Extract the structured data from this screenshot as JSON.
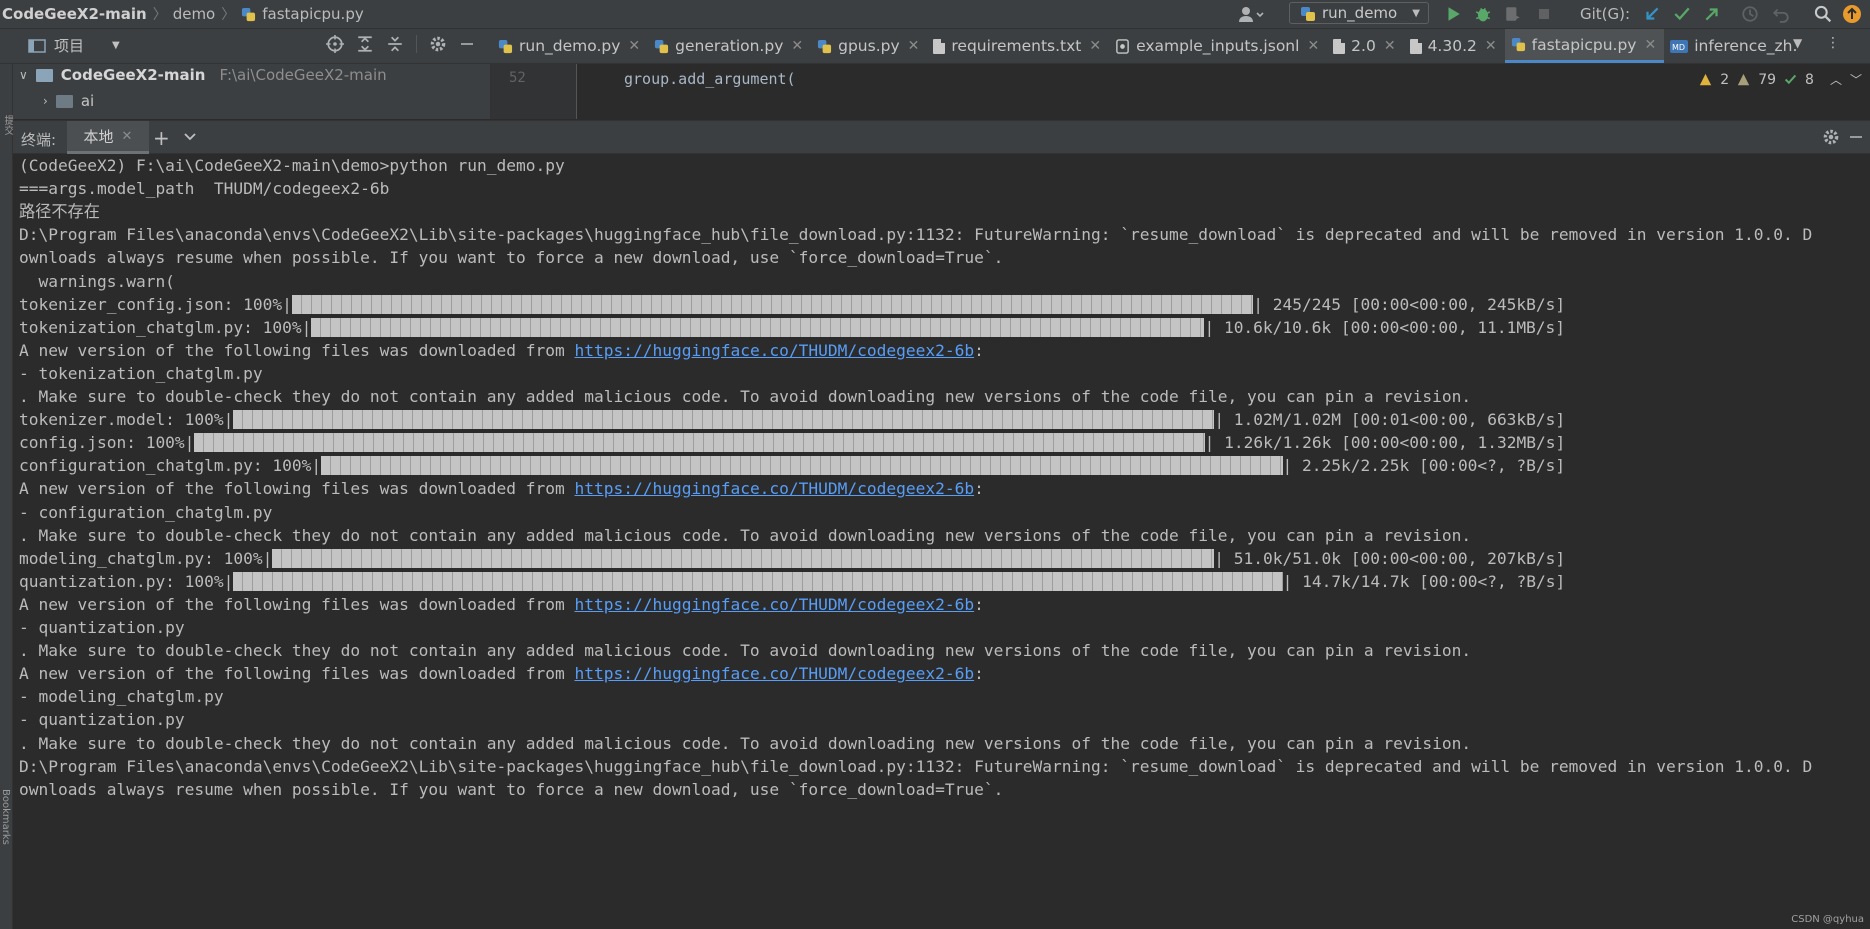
{
  "titlebar": {
    "project": "CodeGeeX2-main",
    "crumb_folder": "demo",
    "crumb_file": "fastapicpu.py",
    "run_config": "run_demo",
    "git_label": "Git(G):"
  },
  "sidebar_strip": {
    "project_label": "项目",
    "bookmarks_label": "Bookmarks",
    "structure_label": "提交"
  },
  "project_tool": {
    "title": "项目"
  },
  "tabs": [
    {
      "label": "run_demo.py",
      "icon": "python-file-icon"
    },
    {
      "label": "generation.py",
      "icon": "python-file-icon"
    },
    {
      "label": "gpus.py",
      "icon": "python-file-icon"
    },
    {
      "label": "requirements.txt",
      "icon": "text-file-icon"
    },
    {
      "label": "example_inputs.jsonl",
      "icon": "json-file-icon"
    },
    {
      "label": "2.0",
      "icon": "text-file-icon"
    },
    {
      "label": "4.30.2",
      "icon": "text-file-icon"
    },
    {
      "label": "fastapicpu.py",
      "icon": "python-file-icon",
      "active": true
    },
    {
      "label": "inference_zh.",
      "icon": "markdown-file-icon"
    }
  ],
  "tree": {
    "root_label": "CodeGeeX2-main",
    "root_path": "F:\\ai\\CodeGeeX2-main",
    "child_label": "ai"
  },
  "editor": {
    "line_number": "52",
    "code_line": "group.add_argument(",
    "errors": "2",
    "warnings": "79",
    "weak_warnings": "8"
  },
  "terminal": {
    "title": "终端:",
    "tab_label": "本地",
    "lines": [
      {
        "text": "(CodeGeeX2) F:\\ai\\CodeGeeX2-main\\demo>python run_demo.py"
      },
      {
        "text": "===args.model_path  THUDM/codegeex2-6b"
      },
      {
        "text": "路径不存在"
      },
      {
        "text": "D:\\Program Files\\anaconda\\envs\\CodeGeeX2\\Lib\\site-packages\\huggingface_hub\\file_download.py:1132: FutureWarning: `resume_download` is deprecated and will be removed in version 1.0.0. D"
      },
      {
        "text": "ownloads always resume when possible. If you want to force a new download, use `force_download=True`."
      },
      {
        "text": "  warnings.warn("
      },
      {
        "prefix": "tokenizer_config.json: 100%|",
        "suffix": "| 245/245 [00:00<00:00, 245kB/s]",
        "progress": 1.0
      },
      {
        "prefix": "tokenization_chatglm.py: 100%|",
        "suffix": "| 10.6k/10.6k [00:00<00:00, 11.1MB/s]",
        "progress": 1.0
      },
      {
        "prefix": "A new version of the following files was downloaded from ",
        "link": "https://huggingface.co/THUDM/codegeex2-6b",
        "after": ":"
      },
      {
        "text": "- tokenization_chatglm.py"
      },
      {
        "text": ". Make sure to double-check they do not contain any added malicious code. To avoid downloading new versions of the code file, you can pin a revision."
      },
      {
        "prefix": "tokenizer.model: 100%|",
        "suffix": "| 1.02M/1.02M [00:01<00:00, 663kB/s]",
        "progress": 1.0
      },
      {
        "prefix": "config.json: 100%|",
        "suffix": "| 1.26k/1.26k [00:00<00:00, 1.32MB/s]",
        "progress": 1.0
      },
      {
        "prefix": "configuration_chatglm.py: 100%|",
        "suffix": "| 2.25k/2.25k [00:00<?, ?B/s]",
        "progress": 1.0
      },
      {
        "prefix": "A new version of the following files was downloaded from ",
        "link": "https://huggingface.co/THUDM/codegeex2-6b",
        "after": ":"
      },
      {
        "text": "- configuration_chatglm.py"
      },
      {
        "text": ". Make sure to double-check they do not contain any added malicious code. To avoid downloading new versions of the code file, you can pin a revision."
      },
      {
        "prefix": "modeling_chatglm.py: 100%|",
        "suffix": "| 51.0k/51.0k [00:00<00:00, 207kB/s]",
        "progress": 1.0
      },
      {
        "prefix": "quantization.py: 100%|",
        "suffix": "| 14.7k/14.7k [00:00<?, ?B/s]",
        "progress": 1.0
      },
      {
        "prefix": "A new version of the following files was downloaded from ",
        "link": "https://huggingface.co/THUDM/codegeex2-6b",
        "after": ":"
      },
      {
        "text": "- quantization.py"
      },
      {
        "text": ". Make sure to double-check they do not contain any added malicious code. To avoid downloading new versions of the code file, you can pin a revision."
      },
      {
        "prefix": "A new version of the following files was downloaded from ",
        "link": "https://huggingface.co/THUDM/codegeex2-6b",
        "after": ":"
      },
      {
        "text": "- modeling_chatglm.py"
      },
      {
        "text": "- quantization.py"
      },
      {
        "text": ". Make sure to double-check they do not contain any added malicious code. To avoid downloading new versions of the code file, you can pin a revision."
      },
      {
        "text": "D:\\Program Files\\anaconda\\envs\\CodeGeeX2\\Lib\\site-packages\\huggingface_hub\\file_download.py:1132: FutureWarning: `resume_download` is deprecated and will be removed in version 1.0.0. D"
      },
      {
        "text": "ownloads always resume when possible. If you want to force a new download, use `force_download=True`."
      }
    ]
  },
  "watermark": "CSDN @qyhua",
  "colors": {
    "background": "#2b2b2b",
    "panel": "#3c3f41",
    "link": "#589df6",
    "accent": "#4a88c7",
    "run_green": "#59a869",
    "warning_yellow": "#e0b33c"
  }
}
